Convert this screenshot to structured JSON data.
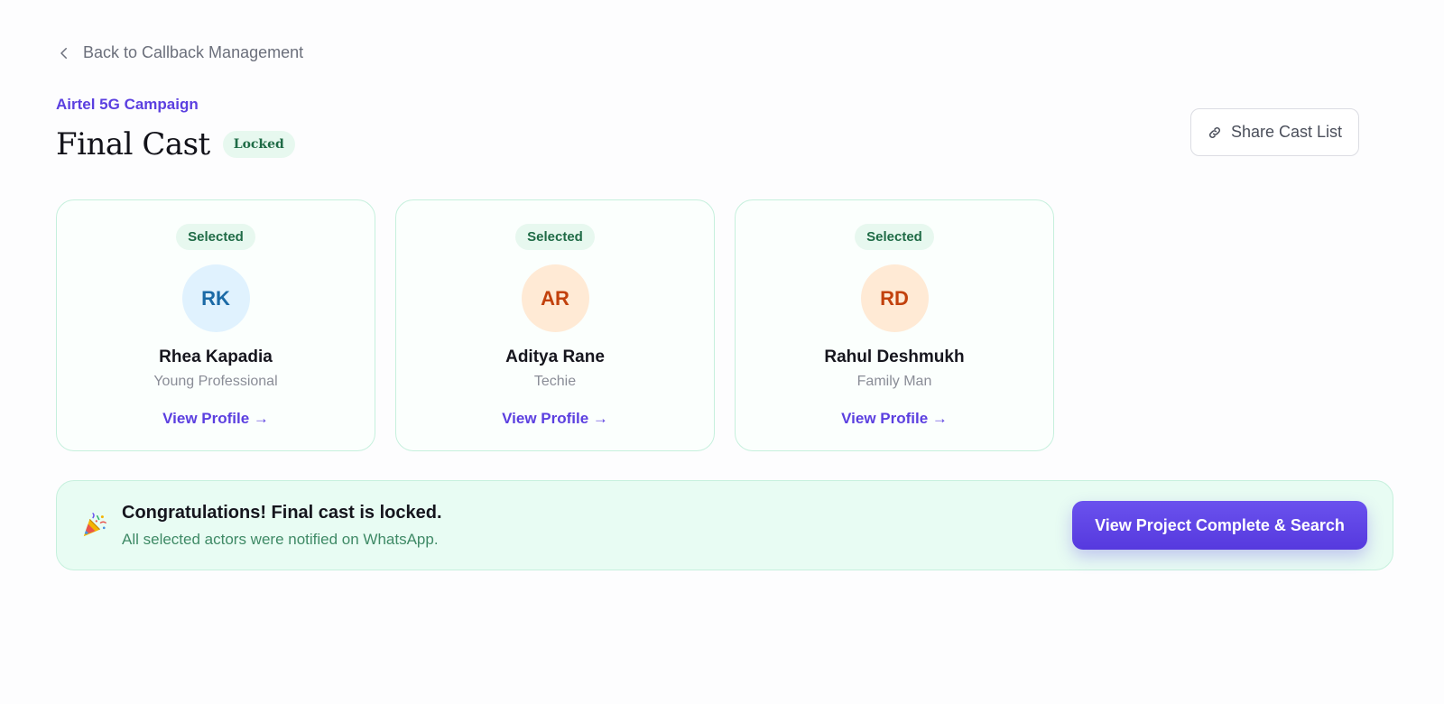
{
  "nav": {
    "back_label": "Back to Callback Management"
  },
  "header": {
    "campaign": "Airtel 5G Campaign",
    "title": "Final Cast",
    "status_badge": "Locked",
    "share_label": "Share Cast List"
  },
  "cast": [
    {
      "badge": "Selected",
      "initials": "RK",
      "name": "Rhea Kapadia",
      "role": "Young Professional",
      "link": "View Profile →",
      "avatar_bg": "#e0f2fe",
      "avatar_fg": "#1b6aa6"
    },
    {
      "badge": "Selected",
      "initials": "AR",
      "name": "Aditya Rane",
      "role": "Techie",
      "link": "View Profile →",
      "avatar_bg": "#ffead5",
      "avatar_fg": "#c2410c"
    },
    {
      "badge": "Selected",
      "initials": "RD",
      "name": "Rahul Deshmukh",
      "role": "Family Man",
      "link": "View Profile →",
      "avatar_bg": "#ffead5",
      "avatar_fg": "#c2410c"
    }
  ],
  "banner": {
    "icon": "party-popper-icon",
    "title": "Congratulations! Final cast is locked.",
    "subtitle": "All selected actors were notified on WhatsApp.",
    "cta_label": "View Project Complete & Search"
  },
  "colors": {
    "accent": "#5b3fe0",
    "success_bg": "#e7f8ef",
    "success_text": "#1f6b46",
    "banner_bg": "#e8fcf3"
  }
}
